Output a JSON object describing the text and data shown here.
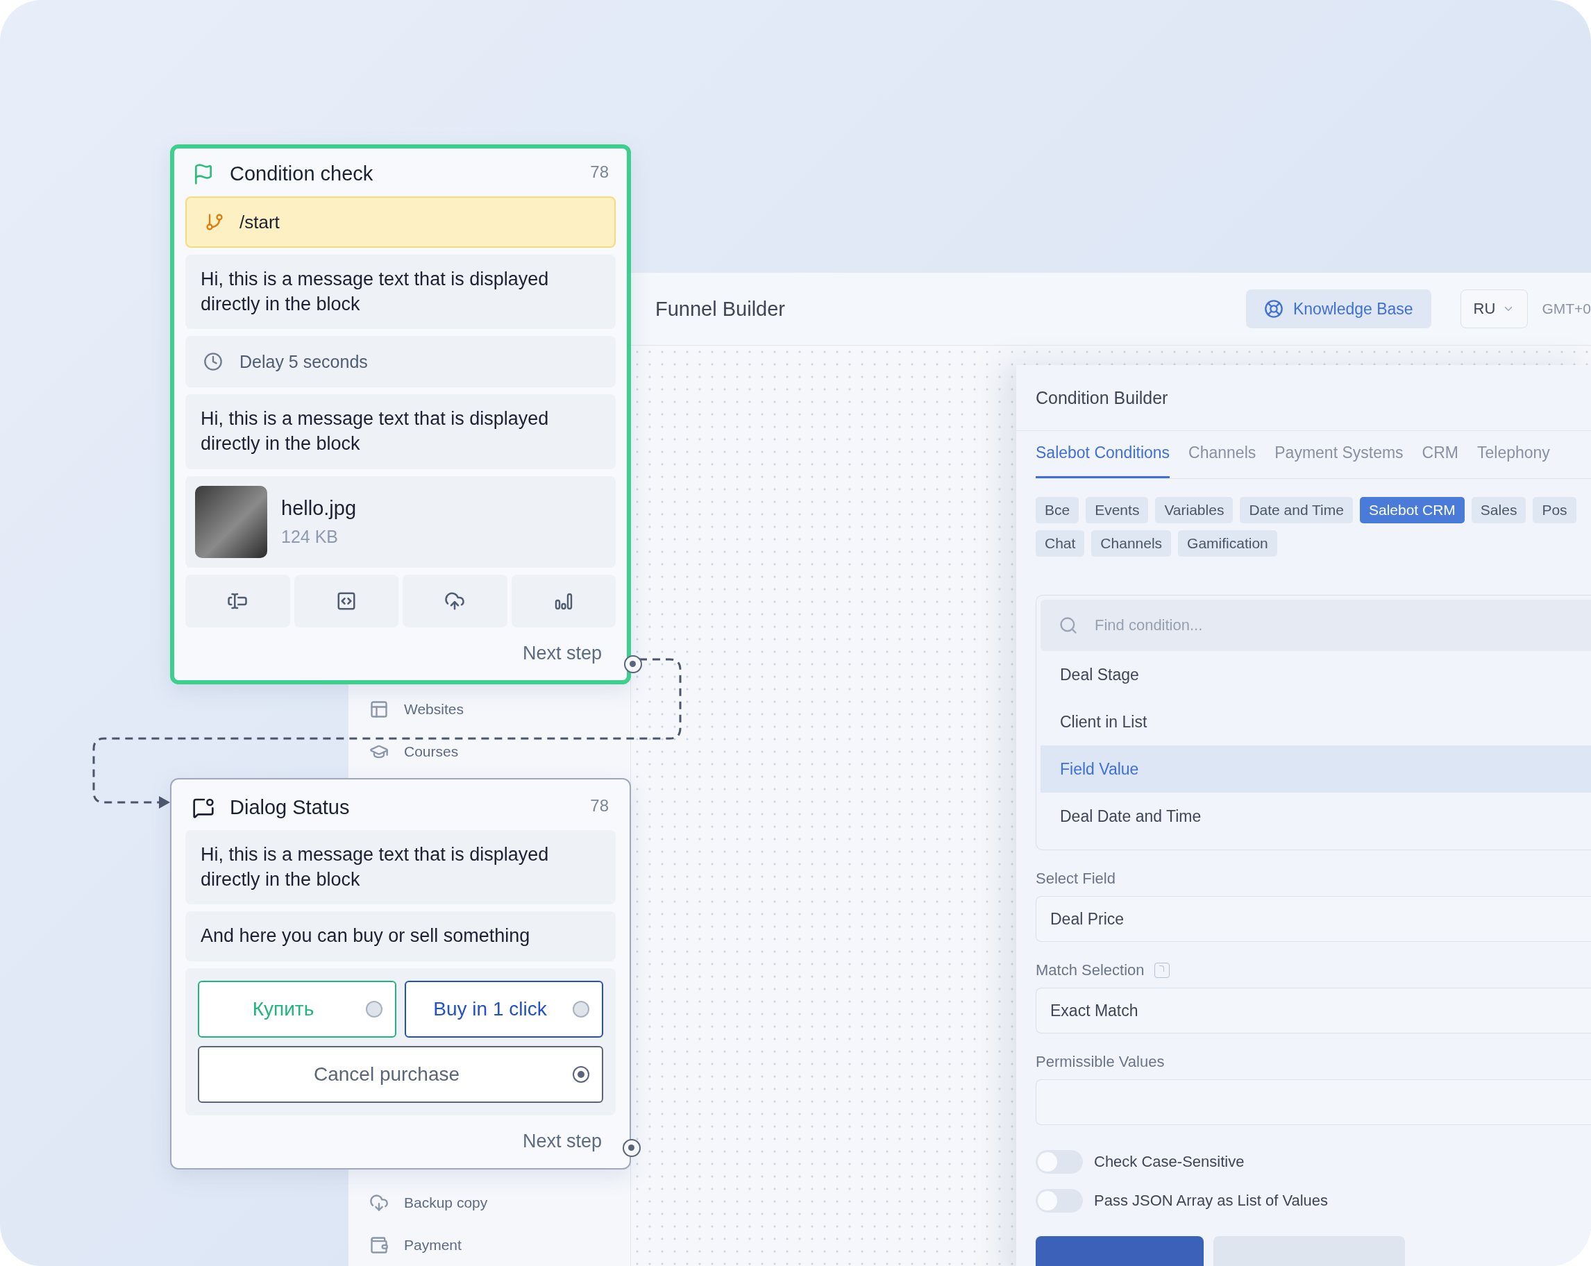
{
  "canvas": {
    "nodes": [
      {
        "kind": "condition",
        "title": "Condition check",
        "count": "78",
        "selected": true,
        "next_label": "Next step",
        "items": [
          {
            "kind": "trigger",
            "text": "/start"
          },
          {
            "kind": "message",
            "text": "Hi, this is a message text that is displayed directly in the block"
          },
          {
            "kind": "delay",
            "text": "Delay 5 seconds"
          },
          {
            "kind": "message",
            "text": "Hi, this is a message text that is displayed directly in the block"
          },
          {
            "kind": "file",
            "name": "hello.jpg",
            "size": "124 KB"
          },
          {
            "kind": "toolbar"
          }
        ]
      },
      {
        "kind": "dialog",
        "title": "Dialog Status",
        "count": "78",
        "selected": false,
        "next_label": "Next step",
        "items": [
          {
            "kind": "message",
            "text": "Hi, this is a message text that is displayed directly in the block"
          },
          {
            "kind": "message",
            "text": "And here you can buy or sell something"
          },
          {
            "kind": "buttons",
            "buttons": [
              {
                "label": "Купить",
                "color": "#1fb57c",
                "linked": false
              },
              {
                "label": "Buy in 1 click",
                "color": "#2150c8",
                "linked": false
              },
              {
                "label": "Cancel purchase",
                "color": "#5b6579",
                "linked": true
              }
            ]
          }
        ]
      }
    ]
  },
  "sidebar": {
    "top_items": [
      {
        "label": "Websites"
      },
      {
        "label": "Courses"
      }
    ],
    "bottom_items": [
      {
        "label": "Backup copy"
      },
      {
        "label": "Payment"
      }
    ]
  },
  "header": {
    "title": "Funnel Builder",
    "help_button": "Knowledge Base",
    "language": "RU",
    "timezone": "GMT+0"
  },
  "condition_builder": {
    "title": "Condition Builder",
    "tabs": [
      {
        "label": "Salebot Conditions",
        "selected": true
      },
      {
        "label": "Channels",
        "selected": false
      },
      {
        "label": "Payment Systems",
        "selected": false
      },
      {
        "label": "CRM",
        "selected": false
      },
      {
        "label": "Telephony",
        "selected": false
      }
    ],
    "chip_rows": [
      [
        {
          "label": "Все",
          "selected": false
        },
        {
          "label": "Events",
          "selected": false
        },
        {
          "label": "Variables",
          "selected": false
        },
        {
          "label": "Date and Time",
          "selected": false
        },
        {
          "label": "Salebot CRM",
          "selected": true
        },
        {
          "label": "Sales",
          "selected": false
        },
        {
          "label": "Pos",
          "selected": false
        }
      ],
      [
        {
          "label": "Chat",
          "selected": false
        },
        {
          "label": "Channels",
          "selected": false
        },
        {
          "label": "Gamification",
          "selected": false
        }
      ]
    ],
    "search": {
      "placeholder": "Find condition..."
    },
    "conditions": [
      {
        "label": "Deal Stage",
        "selected": false
      },
      {
        "label": "Client in List",
        "selected": false
      },
      {
        "label": "Field Value",
        "selected": true
      },
      {
        "label": "Deal Date and Time",
        "selected": false
      }
    ],
    "fields": [
      {
        "label": "Select Field",
        "value": "Deal Price"
      },
      {
        "label": "Match Selection",
        "value": "Exact Match",
        "help": true
      },
      {
        "label": "Permissible Values"
      }
    ],
    "toggles": [
      {
        "label": "Check Case-Sensitive",
        "on": false
      },
      {
        "label": "Pass JSON Array as List of Values",
        "on": false
      }
    ]
  }
}
